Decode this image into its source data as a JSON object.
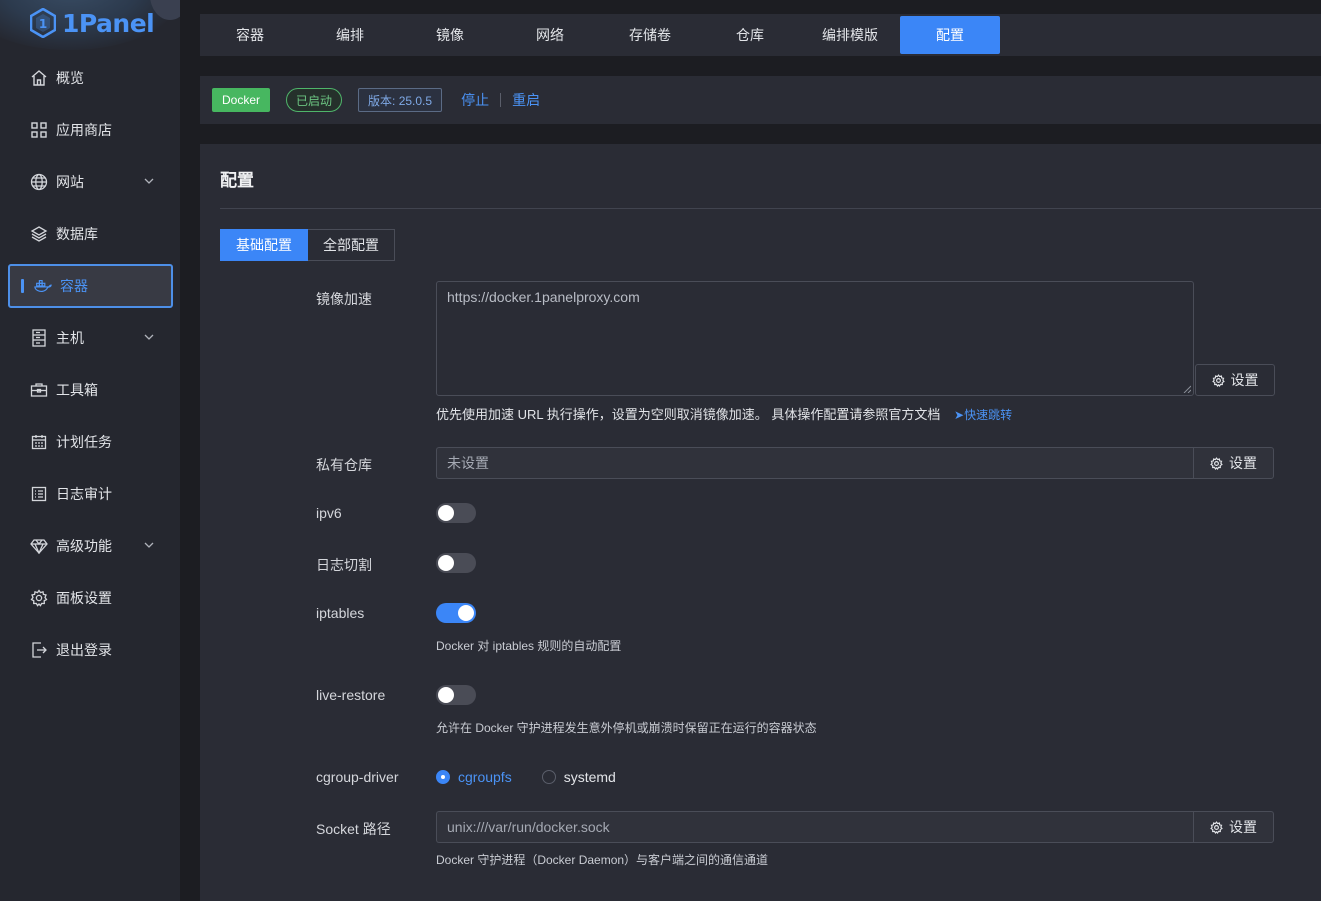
{
  "brand": {
    "name": "1Panel"
  },
  "sidebar": {
    "items": [
      {
        "label": "概览",
        "icon": "home-icon"
      },
      {
        "label": "应用商店",
        "icon": "grid-icon"
      },
      {
        "label": "网站",
        "icon": "globe-icon",
        "expandable": true
      },
      {
        "label": "数据库",
        "icon": "layers-icon"
      },
      {
        "label": "容器",
        "icon": "docker-icon",
        "active": true
      },
      {
        "label": "主机",
        "icon": "server-icon",
        "expandable": true
      },
      {
        "label": "工具箱",
        "icon": "toolbox-icon"
      },
      {
        "label": "计划任务",
        "icon": "calendar-icon"
      },
      {
        "label": "日志审计",
        "icon": "log-icon"
      },
      {
        "label": "高级功能",
        "icon": "diamond-icon",
        "expandable": true
      },
      {
        "label": "面板设置",
        "icon": "gear-icon"
      },
      {
        "label": "退出登录",
        "icon": "logout-icon"
      }
    ]
  },
  "tabs": [
    "容器",
    "编排",
    "镜像",
    "网络",
    "存储卷",
    "仓库",
    "编排模版",
    "配置"
  ],
  "active_tab": "配置",
  "status": {
    "docker_tag": "Docker",
    "running_tag": "已启动",
    "version_tag": "版本: 25.0.5",
    "stop_link": "停止",
    "restart_link": "重启"
  },
  "config": {
    "title": "配置",
    "seg_basic": "基础配置",
    "seg_all": "全部配置",
    "mirror_label": "镜像加速",
    "mirror_value": "https://docker.1panelproxy.com",
    "set_label": "设置",
    "mirror_hint": "优先使用加速 URL 执行操作，设置为空则取消镜像加速。 具体操作配置请参照官方文档",
    "mirror_hint_link": "快速跳转",
    "registry_label": "私有仓库",
    "registry_value": "未设置",
    "ipv6_label": "ipv6",
    "ipv6_on": false,
    "logcut_label": "日志切割",
    "logcut_on": false,
    "iptables_label": "iptables",
    "iptables_on": true,
    "iptables_hint": "Docker 对 iptables 规则的自动配置",
    "live_restore_label": "live-restore",
    "live_restore_on": false,
    "live_restore_hint": "允许在 Docker 守护进程发生意外停机或崩溃时保留正在运行的容器状态",
    "cgroup_label": "cgroup-driver",
    "cgroup_options": [
      "cgroupfs",
      "systemd"
    ],
    "cgroup_selected": "cgroupfs",
    "socket_label": "Socket 路径",
    "socket_value": "unix:///var/run/docker.sock",
    "socket_hint": "Docker 守护进程（Docker Daemon）与客户端之间的通信通道"
  },
  "colors": {
    "accent": "#3b86f7",
    "success": "#47b760",
    "background": "#1c1d22",
    "panel": "#2a2c35"
  }
}
